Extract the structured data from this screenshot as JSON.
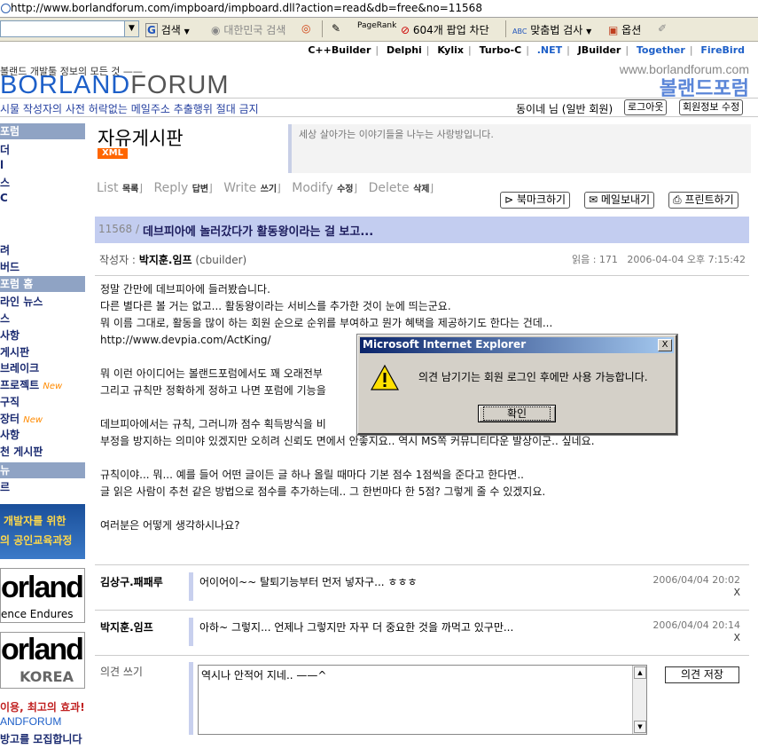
{
  "browser": {
    "address": "http://www.borlandforum.com/impboard/impboard.dll?action=read&db=free&no=11568"
  },
  "toolbar": {
    "search_value": "",
    "search_btn": "검색",
    "korea_search": "대한민국 검색",
    "pagerank": "PageRank",
    "popup_blocked": "604개 팝업 차단",
    "spell_check": "맞춤법 검사",
    "options": "옵션"
  },
  "site": {
    "nav": [
      "C++Builder",
      "Delphi",
      "Kylix",
      "Turbo-C",
      ".NET",
      "JBuilder",
      "Together",
      "FireBird"
    ],
    "slogan": "볼랜드 개발툴 정보의 모든 것 ——",
    "logo_a": "BORLAND",
    "logo_b": "FORUM",
    "url_right": "www.borlandforum.com",
    "logo_kor": "볼랜드포럼",
    "notice": "시물 작성자의 사전 허락없는 메일주소 추출행위 절대 금지",
    "user": "동이네 님 (일반 회원)",
    "logout": "로그아웃",
    "profile_edit": "회원정보 수정"
  },
  "sidebar": {
    "h1": "포럼",
    "g1": [
      "더",
      "l",
      "스",
      "C"
    ],
    "g2": [
      "려",
      "버드"
    ],
    "h2": "포럼 홈",
    "g3": [
      "라인 뉴스",
      "스",
      "사항",
      "게시판",
      "브레이크",
      "프로젝트",
      "구직",
      "장터",
      "사항",
      "천 게시판"
    ],
    "new_badge": "New",
    "h3": "뉴",
    "g4": [
      "르"
    ],
    "banner1_a": "개발자를 위한",
    "banner1_b": "의 공인교육과정",
    "banner2_a": "orland",
    "banner2_b": "ence Endures",
    "banner3_a": "orland",
    "banner3_b": "KOREA",
    "banner4_a": "이용, 최고의 효과!",
    "banner4_b": "ANDFORUM",
    "banner4_c": "방고를 모집합니다"
  },
  "board": {
    "title": "자유게시판",
    "xml": "XML",
    "description": "세상 살아가는 이야기들을 나누는 사랑방입니다.",
    "actions": [
      {
        "en": "List",
        "ko": "목록"
      },
      {
        "en": "Reply",
        "ko": "답변"
      },
      {
        "en": "Write",
        "ko": "쓰기"
      },
      {
        "en": "Modify",
        "ko": "수정"
      },
      {
        "en": "Delete",
        "ko": "삭제"
      }
    ],
    "bookmark": "북마크하기",
    "mail": "메일보내기",
    "print": "프린트하기"
  },
  "post": {
    "number": "11568 /",
    "title": "데브피아에 놀러갔다가 활동왕이라는 걸 보고...",
    "author_label": "작성자 :",
    "author": "박지훈.임프",
    "author_id": "(cbuilder)",
    "views": "읽음 : 171",
    "date": "2006-04-04 오후 7:15:42",
    "lines": [
      "정말 간만에 데브피아에 들러봤습니다.",
      "다른 별다른 볼 거는 없고... 활동왕이라는 서비스를 추가한 것이 눈에 띄는군요.",
      "뭐 이름 그대로, 활동을 많이 하는 회원 순으로 순위를 부여하고 뭔가 혜택을 제공하기도 한다는 건데...",
      "http://www.devpia.com/ActKing/",
      "",
      "뭐 이런 아이디어는 볼랜드포럼에서도 꽤 오래전부",
      "그리고 규칙만 정확하게 정하고 나면 포럼에 기능을",
      "",
      "데브피아에서는 규칙, 그러니까 점수 획득방식을 비",
      "부정을 방지하는 의미야 있겠지만 오히려 신뢰도 면에서 안좋지요.. 역시 MS쪽 커뮤니티다운 발상이군.. 싶네요.",
      "",
      "규칙이야... 뭐... 예를 들어 어떤 글이든 글 하나 올릴 때마다 기본 점수 1점씩을 준다고 한다면..",
      "글 읽은 사람이 추천 같은 방법으로 점수를 추가하는데.. 그 한번마다 한 5점? 그렇게 줄 수 있겠지요.",
      "",
      "여러분은 어떻게 생각하시나요?"
    ]
  },
  "comments": [
    {
      "author": "김상구.패패루",
      "text": "어이어이~~ 탈퇴기능부터 먼저 넣자구... ㅎㅎㅎ",
      "date": "2006/04/04 20:02",
      "del": "X"
    },
    {
      "author": "박지훈.임프",
      "text": "아하~ 그렇지... 언제나 그렇지만 자꾸 더 중요한 것을 까먹고 있구만...",
      "date": "2006/04/04 20:14",
      "del": "X"
    }
  ],
  "write": {
    "label": "의견 쓰기",
    "value": "역시나 안적어 지네.. ——^",
    "save": "의견 저장"
  },
  "dialog": {
    "title": "Microsoft Internet Explorer",
    "message": "의견 남기기는 회원 로그인 후에만 사용 가능합니다.",
    "ok": "확인",
    "close": "X"
  }
}
